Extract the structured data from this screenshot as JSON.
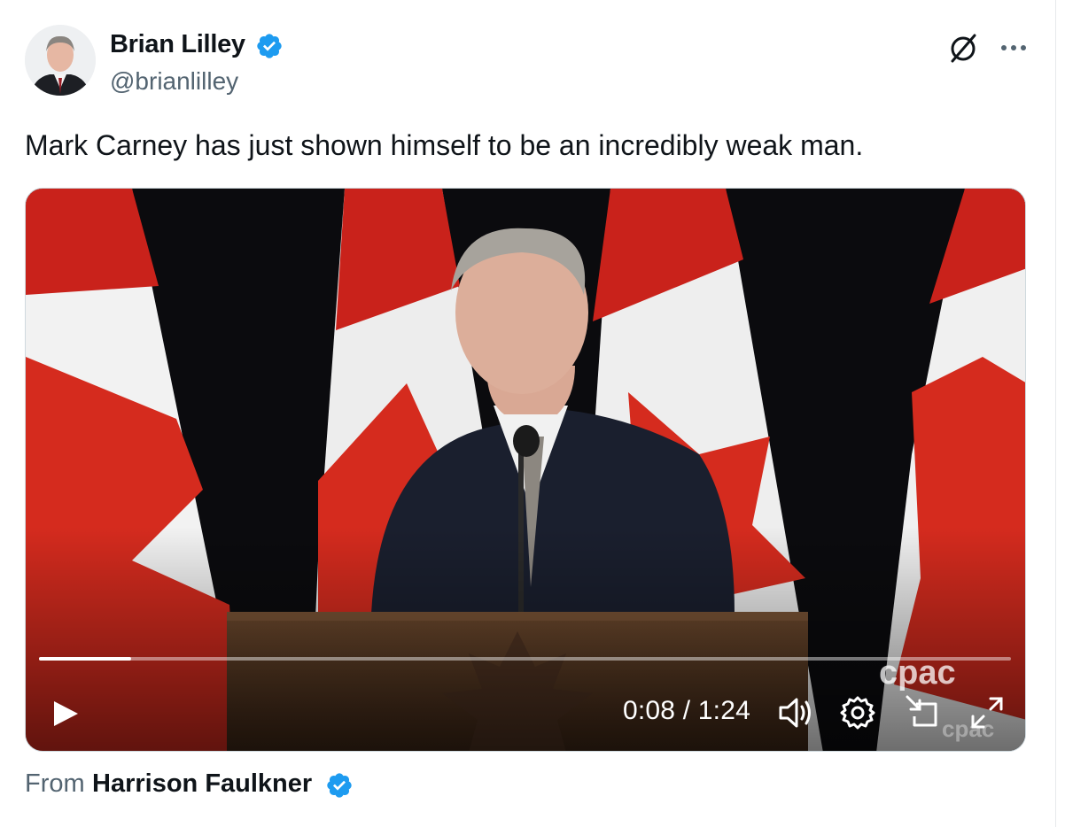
{
  "author": {
    "name": "Brian Lilley",
    "handle": "@brianlilley",
    "verified": true,
    "avatar_icon": "profile-photo"
  },
  "header_actions": {
    "grok_icon": "grok-slash-circle-icon",
    "more_icon": "more-horizontal-icon"
  },
  "tweet": {
    "text": "Mark Carney has just shown himself to be an incredibly weak man."
  },
  "video": {
    "current_time": "0:08",
    "separator": "/",
    "duration": "1:24",
    "time_display": "0:08 / 1:24",
    "progress_fraction": 0.095,
    "watermark": "cpac",
    "controls": [
      "play-icon",
      "volume-icon",
      "settings-gear-icon",
      "picture-in-picture-icon",
      "fullscreen-icon"
    ]
  },
  "attribution": {
    "prefix": "From",
    "name": "Harrison Faulkner",
    "verified": true
  },
  "colors": {
    "verified_blue": "#1d9bf0",
    "secondary_text": "#536471",
    "primary_text": "#0f1419",
    "flag_red": "#d52b1e"
  }
}
